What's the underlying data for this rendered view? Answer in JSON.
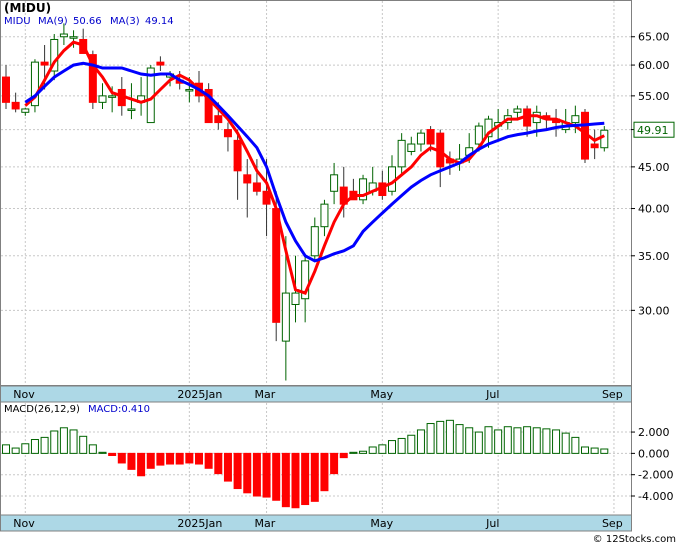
{
  "header": {
    "ticker": "(MIDU)",
    "ma_label": "MIDU",
    "ma9_label": "MA(9)",
    "ma9_value": "50.66",
    "ma3_label": "MA(3)",
    "ma3_value": "49.14",
    "price_tag": "49.91"
  },
  "macd_header": {
    "label": "MACD(26,12,9)",
    "value_label": "MACD:0.410"
  },
  "watermark": "© 12Stocks.com",
  "colors": {
    "up": "#00aa00",
    "down": "#ff0000",
    "ma9": "#0000ff",
    "ma3": "#ff0000",
    "axis_bg": "#add8e6",
    "price_tag_bg": "#ffffff",
    "price_tag_fg": "#006400"
  },
  "chart_data": [
    {
      "type": "candlestick",
      "scale": "log",
      "ylim": [
        24.5,
        70.5
      ],
      "yticks": [
        {
          "v": 65,
          "label": "65.00"
        },
        {
          "v": 60,
          "label": "60.00"
        },
        {
          "v": 55,
          "label": "55.00"
        },
        {
          "v": 50,
          "label": "50.00"
        },
        {
          "v": 45,
          "label": "45.00"
        },
        {
          "v": 40,
          "label": "40.00"
        },
        {
          "v": 35,
          "label": "35.00"
        },
        {
          "v": 30,
          "label": "30.00"
        }
      ],
      "xticks": [
        {
          "i": 2,
          "label": "Nov"
        },
        {
          "i": 19,
          "label": "2025Jan"
        },
        {
          "i": 27,
          "label": "Mar"
        },
        {
          "i": 39,
          "label": "May"
        },
        {
          "i": 51,
          "label": "Jul"
        },
        {
          "i": 63,
          "label": "Sep"
        }
      ],
      "grid": true,
      "candles": [
        [
          58.0,
          60.0,
          53.0,
          54.0
        ],
        [
          54.0,
          55.5,
          52.5,
          53.0
        ],
        [
          52.5,
          53.2,
          52.0,
          53.0
        ],
        [
          53.5,
          61.0,
          52.5,
          60.5
        ],
        [
          60.5,
          63.5,
          56.0,
          60.0
        ],
        [
          59.0,
          65.5,
          57.5,
          64.5
        ],
        [
          65.0,
          67.5,
          63.5,
          65.5
        ],
        [
          65.0,
          66.2,
          63.0,
          65.0
        ],
        [
          64.5,
          66.5,
          62.0,
          62.0
        ],
        [
          61.8,
          62.5,
          53.0,
          54.0
        ],
        [
          54.0,
          57.0,
          53.0,
          55.0
        ],
        [
          55.0,
          56.5,
          52.5,
          55.0
        ],
        [
          56.0,
          58.0,
          52.0,
          53.5
        ],
        [
          53.0,
          57.0,
          51.5,
          53.0
        ],
        [
          54.0,
          58.0,
          52.0,
          55.0
        ],
        [
          51.0,
          60.0,
          51.0,
          59.5
        ],
        [
          60.5,
          61.5,
          59.0,
          60.0
        ],
        [
          58.0,
          59.0,
          56.5,
          58.5
        ],
        [
          57.5,
          59.0,
          56.0,
          57.0
        ],
        [
          56.0,
          58.0,
          54.0,
          56.0
        ],
        [
          57.0,
          59.0,
          54.0,
          55.0
        ],
        [
          56.0,
          57.0,
          51.0,
          51.0
        ],
        [
          52.0,
          54.0,
          50.0,
          51.0
        ],
        [
          50.0,
          51.0,
          47.0,
          49.0
        ],
        [
          48.5,
          50.0,
          41.0,
          44.5
        ],
        [
          44.0,
          46.0,
          39.0,
          43.0
        ],
        [
          43.0,
          46.0,
          41.5,
          42.0
        ],
        [
          42.0,
          46.0,
          37.0,
          40.5
        ],
        [
          40.0,
          42.0,
          27.5,
          29.0
        ],
        [
          27.5,
          37.0,
          24.6,
          31.5
        ],
        [
          30.5,
          35.0,
          29.0,
          31.5
        ],
        [
          31.0,
          35.0,
          29.0,
          34.5
        ],
        [
          35.0,
          39.0,
          34.5,
          38.0
        ],
        [
          38.0,
          41.0,
          37.0,
          40.5
        ],
        [
          42.0,
          45.5,
          40.5,
          44.0
        ],
        [
          42.5,
          45.0,
          39.0,
          40.5
        ],
        [
          42.0,
          43.5,
          41.0,
          41.0
        ],
        [
          41.0,
          44.0,
          40.5,
          43.5
        ],
        [
          42.0,
          45.0,
          41.5,
          43.0
        ],
        [
          43.0,
          44.5,
          41.0,
          41.5
        ],
        [
          42.0,
          46.5,
          41.5,
          45.0
        ],
        [
          45.0,
          49.5,
          44.0,
          48.5
        ],
        [
          47.0,
          49.0,
          46.5,
          48.0
        ],
        [
          48.0,
          50.0,
          47.0,
          49.5
        ],
        [
          50.0,
          50.5,
          47.0,
          48.0
        ],
        [
          49.5,
          50.0,
          42.5,
          45.0
        ],
        [
          46.0,
          47.0,
          44.0,
          45.5
        ],
        [
          45.5,
          48.0,
          44.5,
          46.0
        ],
        [
          46.5,
          49.5,
          45.5,
          47.5
        ],
        [
          48.0,
          51.0,
          47.0,
          50.5
        ],
        [
          49.0,
          52.0,
          47.5,
          51.5
        ],
        [
          50.5,
          53.0,
          48.5,
          51.0
        ],
        [
          51.0,
          53.0,
          50.0,
          52.0
        ],
        [
          52.5,
          53.5,
          51.5,
          53.0
        ],
        [
          53.0,
          53.5,
          49.0,
          50.5
        ],
        [
          51.0,
          53.5,
          49.0,
          52.5
        ],
        [
          52.0,
          52.5,
          50.0,
          51.5
        ],
        [
          51.5,
          53.0,
          49.0,
          51.0
        ],
        [
          50.0,
          53.0,
          49.5,
          51.0
        ],
        [
          51.0,
          53.5,
          49.5,
          52.0
        ],
        [
          52.5,
          53.0,
          45.5,
          46.0
        ],
        [
          48.0,
          50.0,
          46.0,
          47.5
        ],
        [
          47.5,
          50.5,
          47.0,
          49.91
        ]
      ],
      "ma9": [
        null,
        null,
        54.0,
        55.0,
        56.5,
        58.0,
        59.0,
        60.0,
        60.3,
        60.0,
        59.5,
        59.5,
        59.5,
        59.0,
        58.5,
        58.3,
        58.5,
        58.5,
        57.5,
        56.8,
        56.0,
        55.0,
        53.5,
        52.0,
        50.5,
        49.0,
        47.5,
        45.0,
        41.5,
        38.5,
        36.5,
        35.0,
        34.5,
        34.8,
        35.2,
        35.5,
        36.0,
        37.5,
        38.5,
        39.5,
        40.5,
        41.5,
        42.5,
        43.3,
        44.0,
        44.5,
        45.0,
        45.5,
        46.5,
        47.3,
        48.0,
        48.5,
        49.0,
        49.3,
        49.5,
        49.8,
        50.0,
        50.3,
        50.5,
        50.6,
        50.66,
        50.8,
        50.9
      ],
      "ma3": [
        null,
        null,
        53.5,
        54.8,
        57.5,
        60.5,
        62.5,
        64.0,
        63.5,
        60.0,
        58.0,
        55.5,
        55.0,
        54.5,
        54.0,
        54.5,
        56.0,
        57.5,
        58.3,
        57.5,
        56.0,
        54.5,
        53.0,
        51.5,
        49.5,
        47.0,
        44.5,
        43.0,
        40.0,
        35.5,
        31.8,
        31.5,
        33.5,
        36.0,
        38.5,
        40.5,
        41.5,
        41.5,
        42.0,
        42.5,
        43.0,
        44.0,
        45.0,
        46.5,
        47.5,
        47.0,
        46.0,
        45.5,
        46.0,
        47.5,
        49.5,
        50.5,
        51.5,
        51.5,
        52.0,
        52.0,
        51.5,
        51.5,
        51.0,
        50.5,
        49.5,
        48.5,
        49.14
      ]
    },
    {
      "type": "bar",
      "title": "MACD(26,12,9)",
      "ylim": [
        -5.5,
        3.6
      ],
      "yticks": [
        {
          "v": 2,
          "label": "2.000"
        },
        {
          "v": 0,
          "label": "0.000"
        },
        {
          "v": -2,
          "label": "-2.000"
        },
        {
          "v": -4,
          "label": "-4.000"
        }
      ],
      "grid": true,
      "values": [
        0.8,
        0.5,
        0.9,
        1.3,
        1.5,
        2.1,
        2.4,
        2.2,
        1.6,
        0.8,
        0.1,
        -0.2,
        -0.9,
        -1.5,
        -2.1,
        -1.4,
        -1.1,
        -1.0,
        -1.0,
        -0.9,
        -1.0,
        -1.4,
        -1.9,
        -2.6,
        -3.3,
        -3.7,
        -4.0,
        -4.1,
        -4.4,
        -5.0,
        -5.1,
        -4.8,
        -4.5,
        -3.5,
        -1.9,
        -0.4,
        0.1,
        0.2,
        0.6,
        0.8,
        1.2,
        1.4,
        1.7,
        2.2,
        2.8,
        3.0,
        3.1,
        2.7,
        2.4,
        2.0,
        2.5,
        2.2,
        2.5,
        2.4,
        2.5,
        2.4,
        2.3,
        2.2,
        1.9,
        1.5,
        0.6,
        0.5,
        0.41
      ]
    }
  ]
}
